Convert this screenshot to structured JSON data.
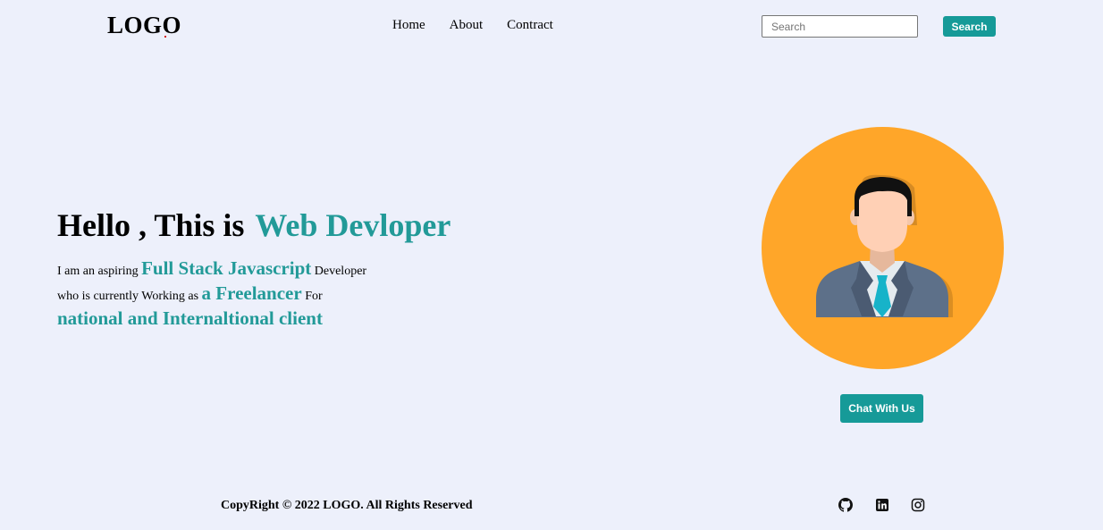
{
  "header": {
    "logo": "LOGO",
    "nav": [
      "Home",
      "About",
      "Contract"
    ],
    "search_placeholder": "Search",
    "search_button": "Search"
  },
  "hero": {
    "title_prefix": "Hello , This is",
    "title_accent": "Web Devloper",
    "desc_1": "I am an aspiring ",
    "desc_hl_1": "Full Stack Javascript",
    "desc_2": " Developer",
    "desc_3": "who is currently Working as ",
    "desc_hl_2": "a Freelancer",
    "desc_4": " For",
    "desc_hl_3": "national and Internaltional client"
  },
  "cta": {
    "chat_button": "Chat With Us"
  },
  "footer": {
    "copyright": "CopyRight © 2022 LOGO. All Rights Reserved",
    "social_icons": [
      "github-icon",
      "linkedin-icon",
      "instagram-icon"
    ]
  },
  "colors": {
    "background": "#edf0fb",
    "accent": "#169a98",
    "avatar_circle": "#ffa629"
  }
}
